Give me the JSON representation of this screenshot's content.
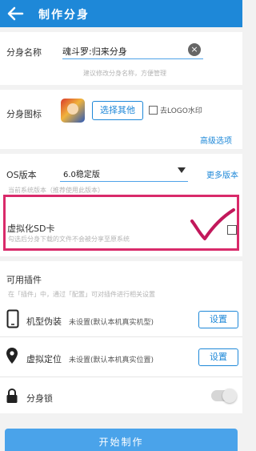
{
  "header": {
    "title": "制作分身"
  },
  "name_section": {
    "label": "分身名称",
    "value": "魂斗罗:归来分身",
    "hint": "建议修改分身名称，方便管理"
  },
  "icon_section": {
    "label": "分身图标",
    "choose_button": "选择其他",
    "logo_checkbox_label": "去LOGO水印",
    "advanced_link": "高级选项"
  },
  "os_section": {
    "label": "OS版本",
    "selected": "6.0稳定版",
    "more_link": "更多版本",
    "hint": "当前系统版本（推荐使用此版本）"
  },
  "sd_section": {
    "label": "虚拟化SD卡",
    "hint": "勾选后分身下载的文件不会被分享至原系统",
    "checked": false
  },
  "plugins": {
    "title": "可用插件",
    "hint": "在「插件」中，通过「配置」可对插件进行相关设置",
    "items": [
      {
        "icon": "phone-icon",
        "name": "机型伪装",
        "status": "未设置(默认本机真实机型)",
        "button": "设置"
      },
      {
        "icon": "location-pin-icon",
        "name": "虚拟定位",
        "status": "未设置(默认本机真实位置)",
        "button": "设置"
      }
    ],
    "lock": {
      "icon": "lock-icon",
      "name": "分身锁",
      "enabled": false
    }
  },
  "footer": {
    "start_button": "开始制作"
  },
  "colors": {
    "brand": "#1e88d8",
    "highlight": "#d92a6a",
    "check": "#c2185b"
  }
}
